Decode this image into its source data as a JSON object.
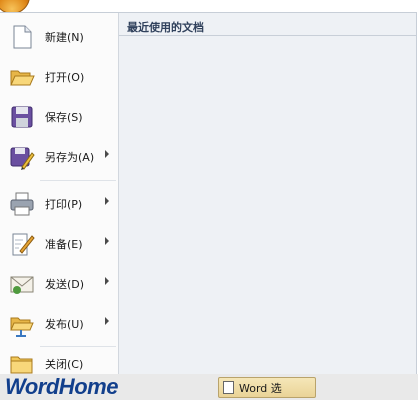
{
  "menu": {
    "items": [
      {
        "label": "新建(N)",
        "icon": "new-document-icon"
      },
      {
        "label": "打开(O)",
        "icon": "open-folder-icon"
      },
      {
        "label": "保存(S)",
        "icon": "save-disk-icon"
      },
      {
        "label": "另存为(A)",
        "icon": "save-as-icon",
        "submenu": true
      },
      {
        "label": "打印(P)",
        "icon": "printer-icon",
        "submenu": true
      },
      {
        "label": "准备(E)",
        "icon": "prepare-icon",
        "submenu": true
      },
      {
        "label": "发送(D)",
        "icon": "send-icon",
        "submenu": true
      },
      {
        "label": "发布(U)",
        "icon": "publish-icon",
        "submenu": true
      },
      {
        "label": "关闭(C)",
        "icon": "close-folder-icon"
      }
    ]
  },
  "recent": {
    "title": "最近使用的文档"
  },
  "footer": {
    "watermark": "WordHome",
    "options_button": "Word 选"
  },
  "colors": {
    "accent": "#123f8c",
    "pane_bg": "#eef1f5"
  }
}
